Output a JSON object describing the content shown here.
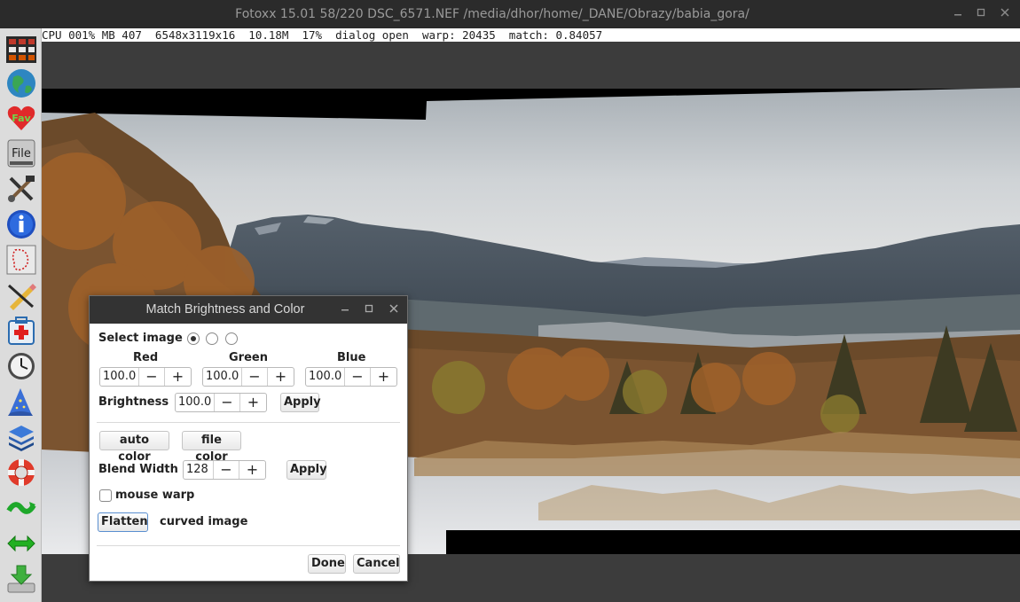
{
  "window": {
    "title": "Fotoxx 15.01  58/220  DSC_6571.NEF  /media/dhor/home/_DANE/Obrazy/babia_gora/",
    "controls": [
      "minimize-icon",
      "maximize-icon",
      "close-icon"
    ]
  },
  "status": {
    "text": "CPU 001% MB 407  6548x3119x16  10.18M  17%  dialog open  warp: 20435  match: 0.84057"
  },
  "toolbar": {
    "items": [
      {
        "name": "gallery-icon",
        "label": ""
      },
      {
        "name": "globe-icon",
        "label": ""
      },
      {
        "name": "favorites-icon",
        "label": "Fav"
      },
      {
        "name": "file-icon",
        "label": "File"
      },
      {
        "name": "tools-icon",
        "label": ""
      },
      {
        "name": "info-icon",
        "label": ""
      },
      {
        "name": "select-icon",
        "label": ""
      },
      {
        "name": "edit-icon",
        "label": ""
      },
      {
        "name": "repair-icon",
        "label": ""
      },
      {
        "name": "clock-icon",
        "label": ""
      },
      {
        "name": "wizard-icon",
        "label": ""
      },
      {
        "name": "layers-icon",
        "label": ""
      },
      {
        "name": "help-icon",
        "label": ""
      },
      {
        "name": "warp-icon",
        "label": ""
      },
      {
        "name": "resize-icon",
        "label": ""
      },
      {
        "name": "save-icon",
        "label": ""
      }
    ]
  },
  "dialog": {
    "title": "Match Brightness and Color",
    "select_image_label": "Select image",
    "select_image_selected": 0,
    "red_label": "Red",
    "green_label": "Green",
    "blue_label": "Blue",
    "red_value": "100.0",
    "green_value": "100.0",
    "blue_value": "100.0",
    "brightness_label": "Brightness",
    "brightness_value": "100.0",
    "apply_label": "Apply",
    "auto_color_label": "auto color",
    "file_color_label": "file color",
    "blend_width_label": "Blend Width",
    "blend_width_value": "128",
    "apply2_label": "Apply",
    "mouse_warp_label": "mouse warp",
    "mouse_warp_checked": false,
    "flatten_label": "Flatten",
    "curved_image_label": "curved image",
    "done_label": "Done",
    "cancel_label": "Cancel",
    "minus": "−",
    "plus": "+"
  }
}
